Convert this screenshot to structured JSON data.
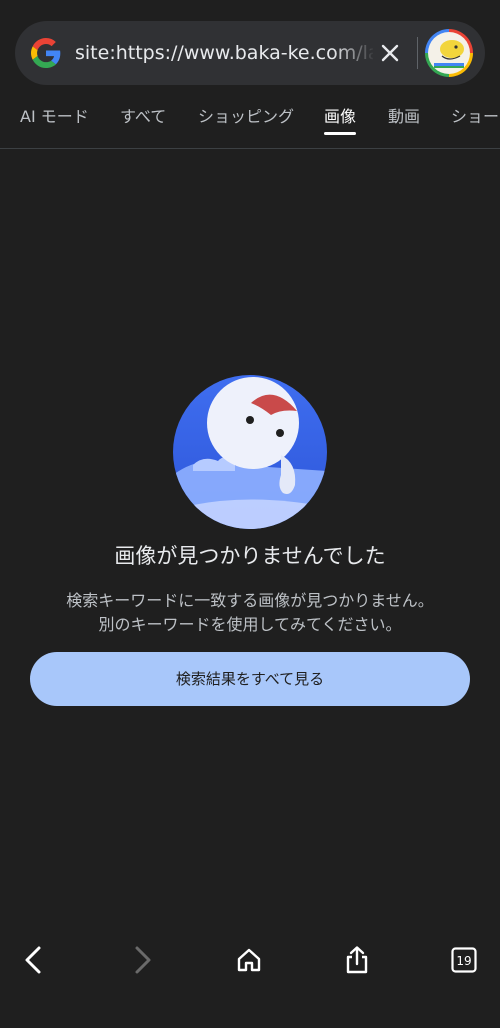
{
  "search": {
    "query": "site:https://www.baka-ke.com/lab",
    "clear_icon": "close-icon",
    "logo_icon": "google-g-icon",
    "avatar_icon": "profile-avatar"
  },
  "tabs": [
    {
      "label": "AI モード",
      "active": false
    },
    {
      "label": "すべて",
      "active": false
    },
    {
      "label": "ショッピング",
      "active": false
    },
    {
      "label": "画像",
      "active": true
    },
    {
      "label": "動画",
      "active": false
    },
    {
      "label": "ショー",
      "active": false
    }
  ],
  "empty_state": {
    "title": "画像が見つかりませんでした",
    "description_line1": "検索キーワードに一致する画像が見つかりません。",
    "description_line2": "別のキーワードを使用してみてください。",
    "button_label": "検索結果をすべて見る"
  },
  "toolbar": {
    "tab_count": "19",
    "back_icon": "back-arrow-icon",
    "forward_icon": "forward-arrow-icon",
    "home_icon": "home-icon",
    "share_icon": "share-icon",
    "tabs_icon": "tabs-counter-icon"
  },
  "colors": {
    "background": "#1f1f1f",
    "search_bar": "#303134",
    "button": "#a8c7fa",
    "illustration_blue": "#3b63e6"
  }
}
